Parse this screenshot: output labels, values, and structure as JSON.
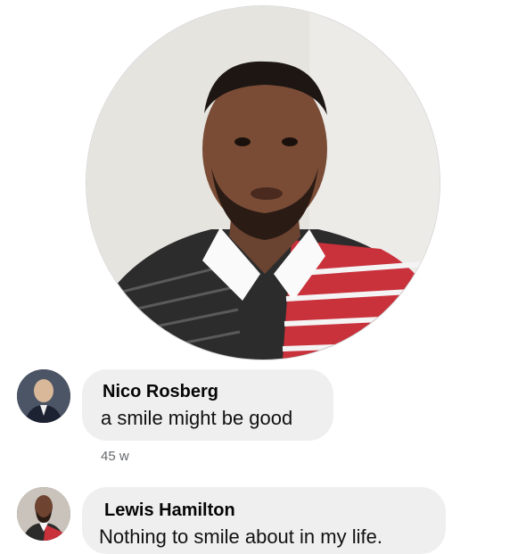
{
  "comments": [
    {
      "author": "Nico Rosberg",
      "text": "a smile might be good",
      "time": "45 w"
    },
    {
      "author": "Lewis Hamilton",
      "text": "Nothing to smile about in my life."
    }
  ],
  "colors": {
    "bubble": "#efefef",
    "timestamp": "#65676b",
    "text": "#050505"
  }
}
